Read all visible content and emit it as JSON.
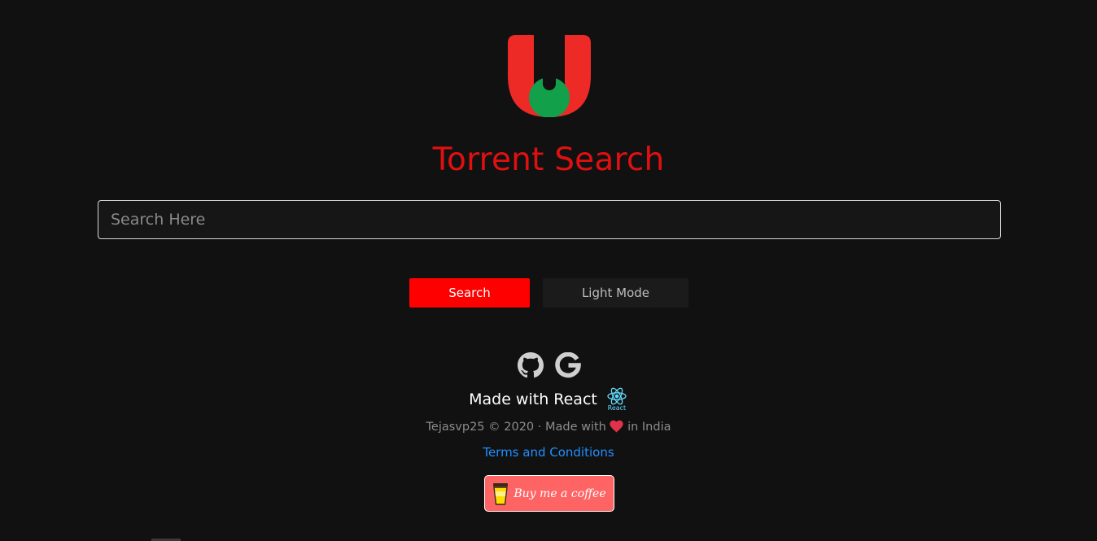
{
  "app": {
    "title": "Torrent Search",
    "logo_icon": "u-magnet-logo",
    "colors": {
      "background": "#121112",
      "title": "#e01010",
      "accent_red": "#ff0000",
      "logo_red": "#ee2a27",
      "logo_green": "#12a04a"
    }
  },
  "search": {
    "placeholder": "Search Here",
    "value": ""
  },
  "buttons": {
    "search_label": "Search",
    "light_mode_label": "Light Mode"
  },
  "footer": {
    "social_icons": [
      "github-icon",
      "google-icon"
    ],
    "made_with_react": "Made with React",
    "react_logo_label": "React",
    "copyright_prefix": "Tejasvp25 © 2020 · Made with",
    "copyright_suffix": "in India",
    "terms_link": "Terms and Conditions",
    "coffee_button": "Buy me a coffee"
  }
}
